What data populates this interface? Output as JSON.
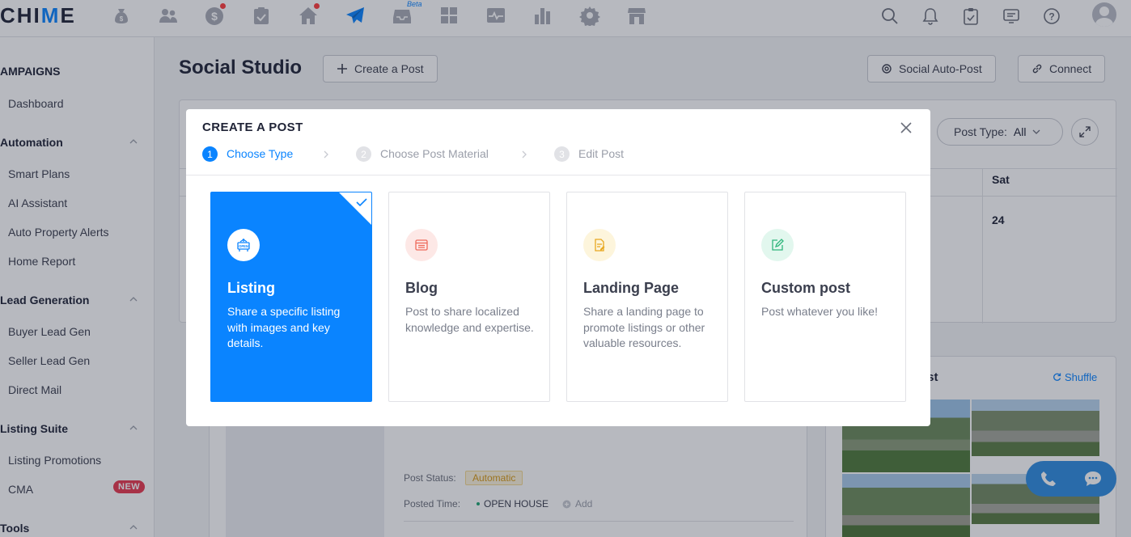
{
  "app": {
    "logo_prefix": "CHI",
    "logo_m": "M",
    "logo_suffix": "E"
  },
  "topnav": {
    "beta_label": "Beta",
    "icons": [
      "money-bag-icon",
      "people-icon",
      "dollar-icon",
      "clipboard-check-icon",
      "house-icon",
      "paper-plane-icon",
      "inbox-icon",
      "grid-icon",
      "pulse-icon",
      "bar-chart-icon",
      "gear-icon",
      "store-icon"
    ]
  },
  "sidebar": {
    "section_campaigns": "AMPAIGNS",
    "dashboard": "Dashboard",
    "automation": "Automation",
    "smart_plans": "Smart Plans",
    "ai_assistant": "AI Assistant",
    "auto_property_alerts": "Auto Property Alerts",
    "home_report": "Home Report",
    "lead_generation": "Lead Generation",
    "buyer_lead_gen": "Buyer Lead Gen",
    "seller_lead_gen": "Seller Lead Gen",
    "direct_mail": "Direct Mail",
    "listing_suite": "Listing Suite",
    "listing_promotions": "Listing Promotions",
    "cma": "CMA",
    "new_badge": "NEW",
    "tools": "Tools"
  },
  "page": {
    "title": "Social Studio",
    "create_post_btn": "Create a Post",
    "social_autopost_btn": "Social Auto-Post",
    "connect_btn": "Connect",
    "post_type_label": "Post Type:",
    "post_type_value": "All",
    "sat_header": "Sat",
    "sat_day": "24",
    "shuffle": "Shuffle",
    "ost_partial": "ost",
    "post_status_label": "Post Status:",
    "post_status_value": "Automatic",
    "posted_time_label": "Posted Time:",
    "posted_time_value": "OPEN HOUSE",
    "add_label": "Add"
  },
  "modal": {
    "title": "CREATE A POST",
    "steps": [
      {
        "num": "1",
        "label": "Choose Type",
        "active": true
      },
      {
        "num": "2",
        "label": "Choose Post Material",
        "active": false
      },
      {
        "num": "3",
        "label": "Edit Post",
        "active": false
      }
    ],
    "cards": [
      {
        "title": "Listing",
        "desc": "Share a specific listing with images and key details.",
        "selected": true,
        "icon": "open-house-sign-icon"
      },
      {
        "title": "Blog",
        "desc": "Post to share localized knowledge and expertise.",
        "selected": false,
        "icon": "browser-window-icon"
      },
      {
        "title": "Landing Page",
        "desc": "Share a landing page to promote listings or other valuable resources.",
        "selected": false,
        "icon": "document-edit-icon"
      },
      {
        "title": "Custom post",
        "desc": "Post whatever you like!",
        "selected": false,
        "icon": "pencil-square-icon"
      }
    ],
    "open_sign_text": "OPEN"
  },
  "colors": {
    "accent": "#0a84ff",
    "blog_icon_bg": "#fde8e6",
    "landing_icon_bg": "#fdf5dc",
    "custom_icon_bg": "#e2f7ee"
  }
}
